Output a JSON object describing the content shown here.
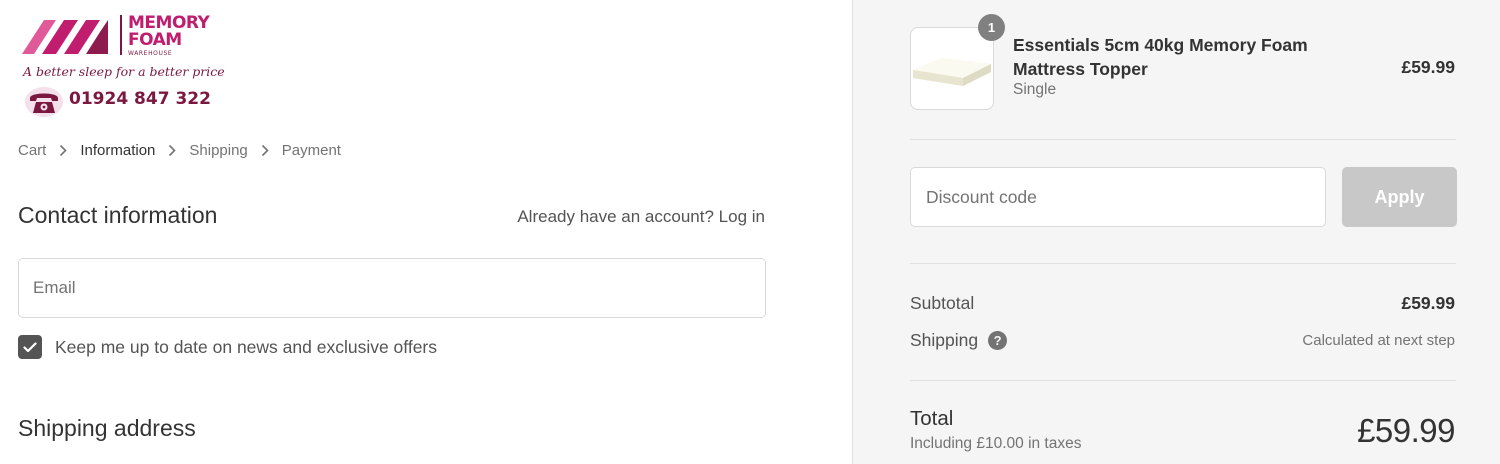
{
  "brand": {
    "name_line1": "MEMORY",
    "name_line2": "FOAM",
    "name_line3": "WAREHOUSE",
    "tagline": "A better sleep for a better price",
    "phone": "01924 847 322",
    "colors": {
      "primary": "#c01d6f",
      "dark": "#7a1840",
      "light": "#e05a9a"
    }
  },
  "breadcrumb": {
    "items": [
      {
        "label": "Cart",
        "active": false
      },
      {
        "label": "Information",
        "active": true
      },
      {
        "label": "Shipping",
        "active": false
      },
      {
        "label": "Payment",
        "active": false
      }
    ],
    "separator_icon": "chevron-right-icon"
  },
  "contact": {
    "title": "Contact information",
    "account_prompt": "Already have an account?",
    "login_label": "Log in",
    "email_placeholder": "Email",
    "newsletter_label": "Keep me up to date on news and exclusive offers",
    "newsletter_checked": true
  },
  "shipping_section": {
    "title": "Shipping address"
  },
  "order": {
    "item": {
      "quantity": "1",
      "name": "Essentials 5cm 40kg Memory Foam Mattress Topper",
      "variant": "Single",
      "price": "£59.99"
    },
    "discount": {
      "placeholder": "Discount code",
      "apply_label": "Apply"
    },
    "subtotal": {
      "label": "Subtotal",
      "value": "£59.99"
    },
    "shipping": {
      "label": "Shipping",
      "value": "Calculated at next step",
      "help_icon": "question-circle-icon"
    },
    "total": {
      "label": "Total",
      "tax_note": "Including £10.00 in taxes",
      "value": "£59.99"
    }
  },
  "colors": {
    "sidebar_bg": "#f5f5f5",
    "text_dark": "#333333",
    "text_muted": "#737373",
    "border": "#d9d9d9",
    "button_disabled": "#c8c8c8"
  }
}
